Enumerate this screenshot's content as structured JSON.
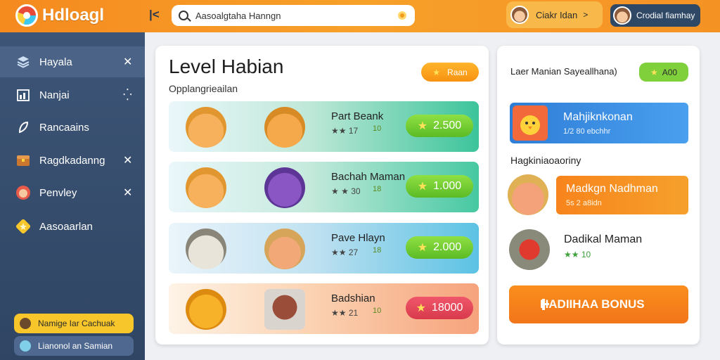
{
  "app": {
    "brand": "Hdloagl"
  },
  "search": {
    "value": "Aasoalgtaha Hanngn"
  },
  "header": {
    "user1": {
      "name": "Ciakr Idan",
      "arrow": ">"
    },
    "user2": {
      "name": "Crodial fiamhay"
    }
  },
  "sidebar": {
    "items": [
      {
        "label": "Hayala",
        "icon": "layers-icon"
      },
      {
        "label": "Nanjai",
        "icon": "chart-icon"
      },
      {
        "label": "Rancaains",
        "icon": "leaf-icon"
      },
      {
        "label": "Ragdkadanng",
        "icon": "chest-icon"
      },
      {
        "label": "Penvley",
        "icon": "avatar-icon"
      },
      {
        "label": "Aasoaarlan",
        "icon": "star-icon"
      }
    ],
    "bottom": [
      {
        "label": "Namige Iar Cachuak"
      },
      {
        "label": "Lianonol an Samian"
      }
    ]
  },
  "main": {
    "title": "Level Habian",
    "subtitle": "Opplangrieailan",
    "button": "Raan",
    "rows": [
      {
        "title": "Part Beank",
        "stars": "17",
        "count": "10",
        "price": "2.500",
        "color": "#7fd03b"
      },
      {
        "title": "Bachah Maman",
        "stars": "30",
        "count": "18",
        "price": "1.000",
        "color": "#7fd03b"
      },
      {
        "title": "Pave Hlayn",
        "stars": "27",
        "count": "18",
        "price": "2.000",
        "color": "#7fd03b"
      },
      {
        "title": "Badshian",
        "stars": "21",
        "count": "10",
        "price": "18000",
        "color": "#e84a55"
      }
    ]
  },
  "right": {
    "header": "Laer Manian Sayeallhana)",
    "badge": "A00",
    "card1": {
      "title": "Mahjiknkonan",
      "sub": "1/2 80 ebchhr"
    },
    "section": "Hagkiniaoaoriny",
    "card2": {
      "title": "Madkgn Nadhman",
      "sub": "5s 2 a8idn"
    },
    "item3": {
      "title": "Dadikal Maman",
      "stars": "10"
    },
    "bonus": "HADIIHAA BONUS"
  }
}
